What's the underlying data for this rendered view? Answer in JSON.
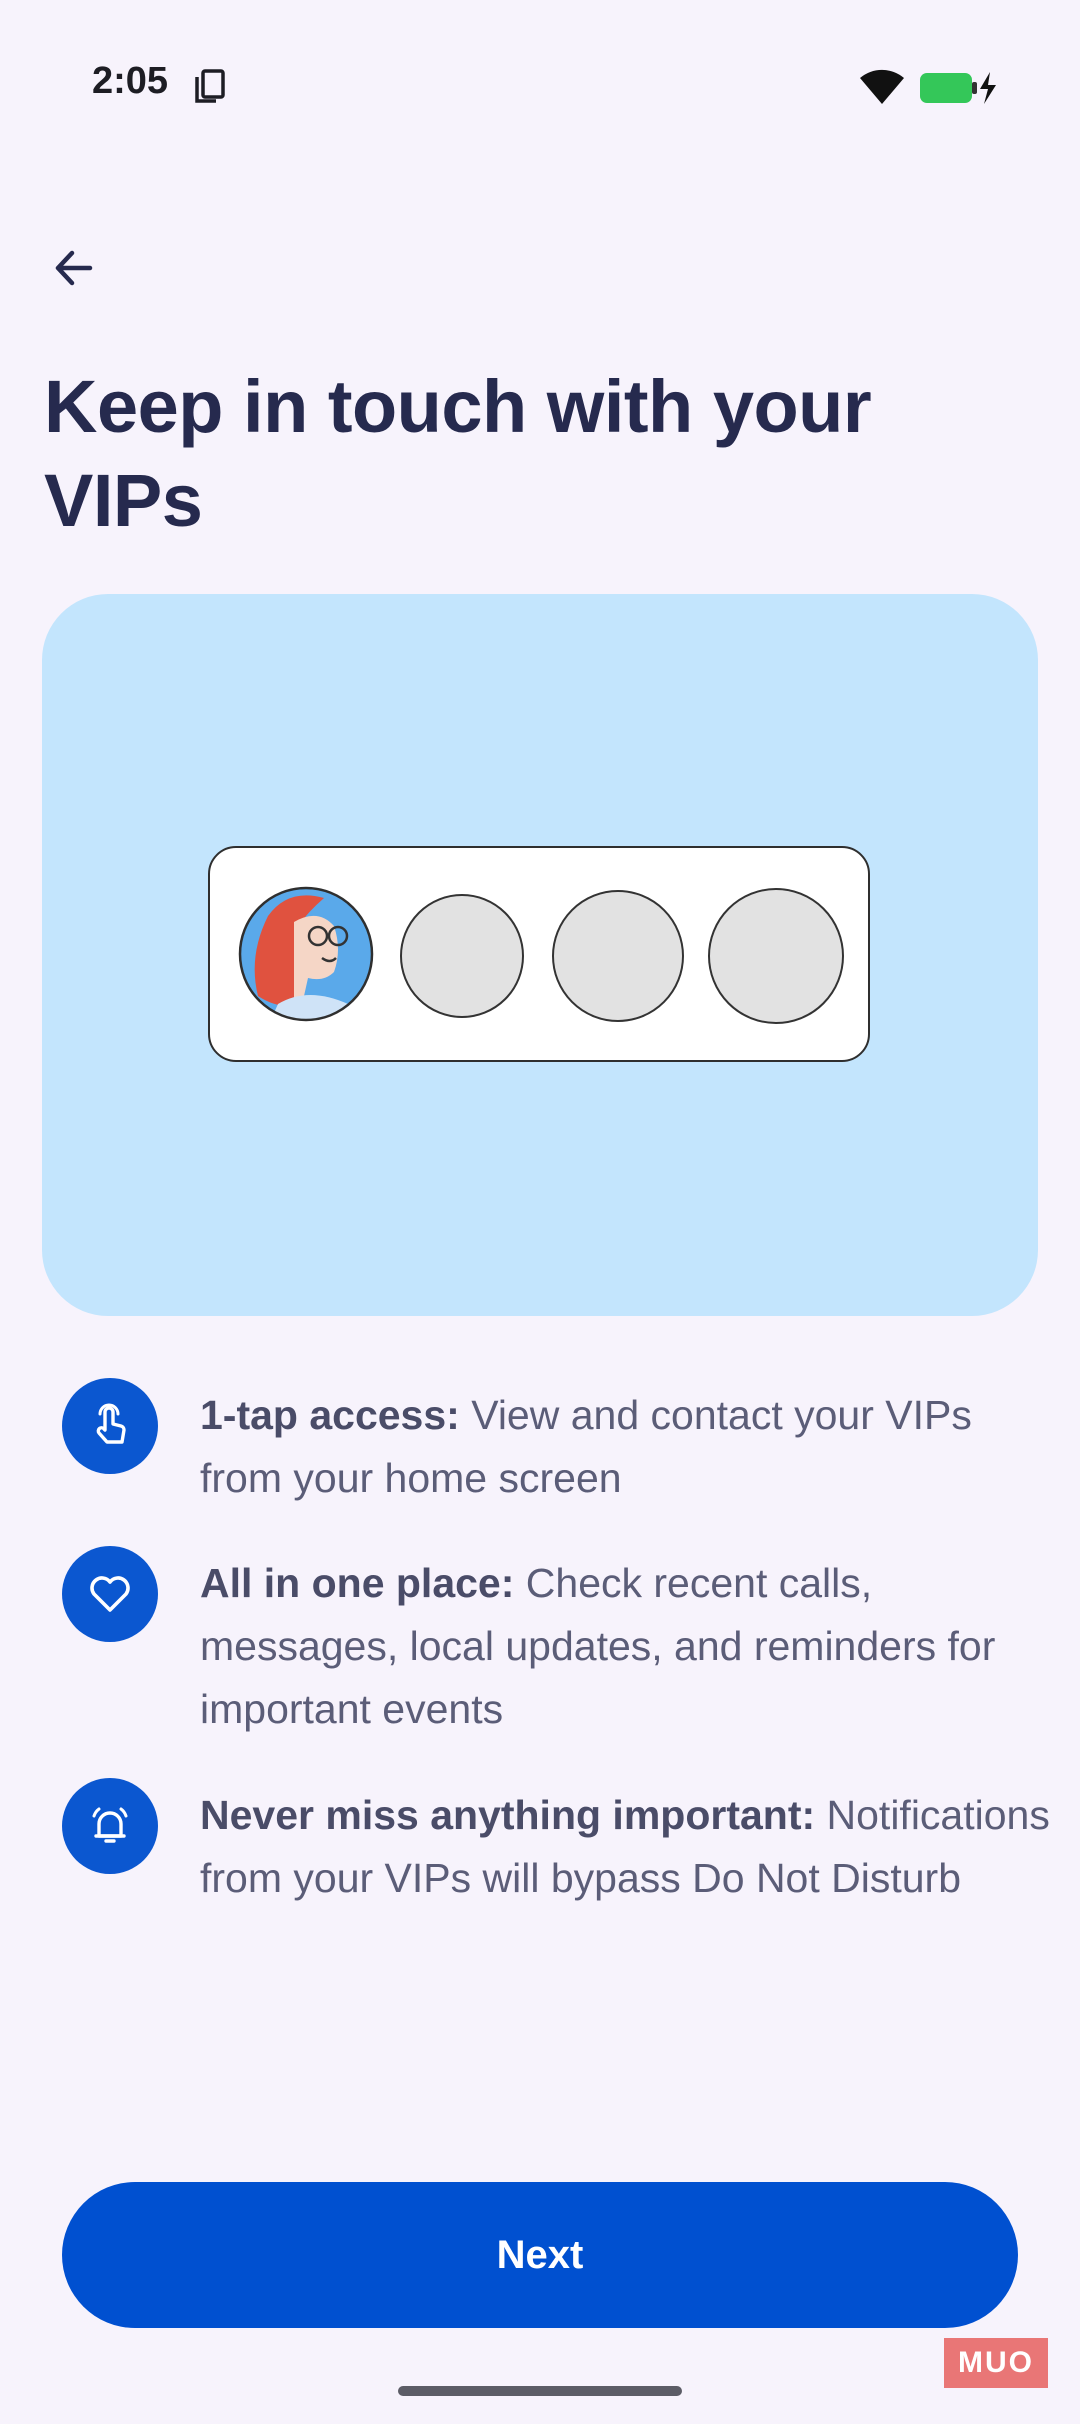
{
  "status_bar": {
    "time": "2:05",
    "icons": [
      "copy-icon",
      "wifi-icon",
      "battery-charging-icon"
    ],
    "battery_color": "#34c759"
  },
  "header": {
    "back_icon": "arrow-left-icon",
    "title": "Keep in touch with your VIPs"
  },
  "hero": {
    "background": "#c3e5fd",
    "vip_slots": [
      "avatar",
      "empty",
      "empty",
      "empty"
    ]
  },
  "features": [
    {
      "icon": "tap-hand-icon",
      "heading": "1-tap access:",
      "body": " View and contact your VIPs from your home screen"
    },
    {
      "icon": "heart-icon",
      "heading": "All in one place:",
      "body": " Check recent calls, messages, local updates, and reminders for important events"
    },
    {
      "icon": "notification-bell-icon",
      "heading": "Never miss anything important:",
      "body": " Notifications from your VIPs will bypass Do Not Disturb"
    }
  ],
  "accent_color": "#0b57d0",
  "footer": {
    "next_label": "Next"
  },
  "watermark": "MUO"
}
